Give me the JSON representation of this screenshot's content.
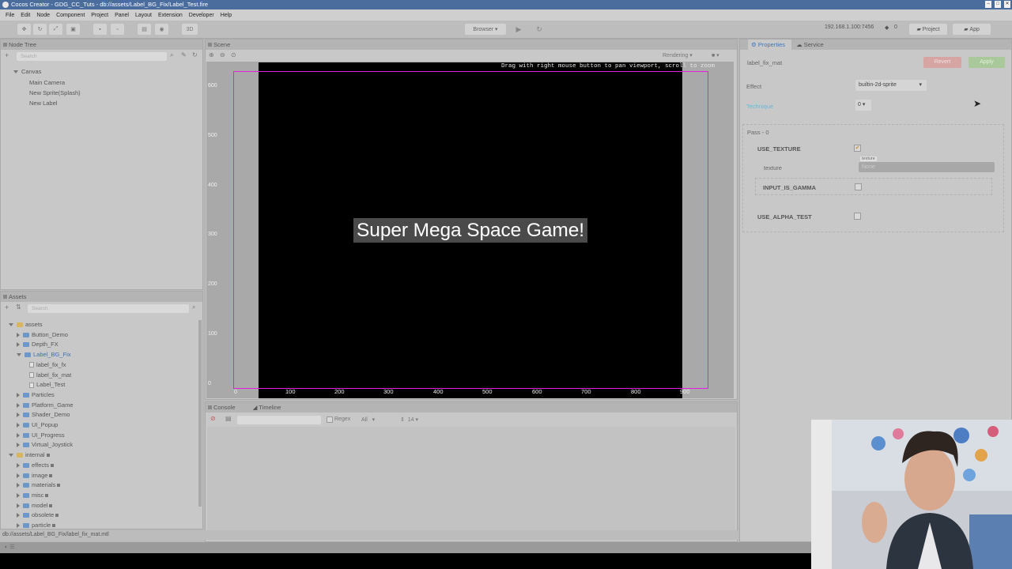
{
  "window": {
    "title": "Cocos Creator - GDG_CC_Tuts - db://assets/Label_BG_Fix/Label_Test.fire"
  },
  "menu": [
    "File",
    "Edit",
    "Node",
    "Component",
    "Project",
    "Panel",
    "Layout",
    "Extension",
    "Developer",
    "Help"
  ],
  "toolbar": {
    "mode_3d": "3D",
    "browser": "Browser",
    "ip": "192.168.1.100:7456",
    "count": "0",
    "project": "Project",
    "app": "App"
  },
  "node_tree": {
    "title": "Node Tree",
    "search_placeholder": "Search",
    "items": [
      "Canvas",
      "Main Camera",
      "New Sprite(Splash)",
      "New Label"
    ]
  },
  "scene": {
    "title": "Scene",
    "rendering": "Rendering",
    "hint": "Drag with right mouse button to pan viewport, scroll to zoom",
    "label_text": "Super Mega Space Game!",
    "y_ticks": [
      "600",
      "500",
      "400",
      "300",
      "200",
      "100",
      "0"
    ],
    "x_ticks": [
      "0",
      "100",
      "200",
      "300",
      "400",
      "500",
      "600",
      "700",
      "800",
      "900"
    ]
  },
  "console": {
    "tab_console": "Console",
    "tab_timeline": "Timeline",
    "regex": "Regex",
    "filter": "All",
    "font_size": "14"
  },
  "assets": {
    "title": "Assets",
    "search_placeholder": "Search",
    "items": [
      {
        "name": "assets",
        "type": "root"
      },
      {
        "name": "Button_Demo",
        "type": "folder"
      },
      {
        "name": "Depth_FX",
        "type": "folder"
      },
      {
        "name": "Label_BG_Fix",
        "type": "folder-open"
      },
      {
        "name": "label_fix_fx",
        "type": "file"
      },
      {
        "name": "label_fix_mat",
        "type": "file"
      },
      {
        "name": "Label_Test",
        "type": "file"
      },
      {
        "name": "Particles",
        "type": "folder"
      },
      {
        "name": "Platform_Game",
        "type": "folder"
      },
      {
        "name": "Shader_Demo",
        "type": "folder"
      },
      {
        "name": "UI_Popup",
        "type": "folder"
      },
      {
        "name": "UI_Progress",
        "type": "folder"
      },
      {
        "name": "Virtual_Joystick",
        "type": "folder"
      },
      {
        "name": "internal",
        "type": "root-locked"
      },
      {
        "name": "effects",
        "type": "folder-locked"
      },
      {
        "name": "image",
        "type": "folder-locked"
      },
      {
        "name": "materials",
        "type": "folder-locked"
      },
      {
        "name": "misc",
        "type": "folder-locked"
      },
      {
        "name": "model",
        "type": "folder-locked"
      },
      {
        "name": "obsolete",
        "type": "folder-locked"
      },
      {
        "name": "particle",
        "type": "folder-locked"
      }
    ],
    "status_path": "db://assets/Label_BG_Fix/label_fix_mat.mtl"
  },
  "properties": {
    "tab_properties": "Properties",
    "tab_service": "Service",
    "asset_name": "label_fix_mat",
    "revert": "Revert",
    "apply": "Apply",
    "effect_label": "Effect",
    "effect_value": "builtin-2d-sprite",
    "technique_label": "Technique",
    "technique_value": "0",
    "pass_label": "Pass - 0",
    "use_texture": "USE_TEXTURE",
    "texture_label": "texture",
    "texture_tag": "texture",
    "texture_value": "None",
    "input_is_gamma": "INPUT_IS_GAMMA",
    "use_alpha_test": "USE_ALPHA_TEST"
  },
  "colors": {
    "accent": "#4a6d9e",
    "selection": "#e21ee2",
    "canvas": "#000000"
  }
}
